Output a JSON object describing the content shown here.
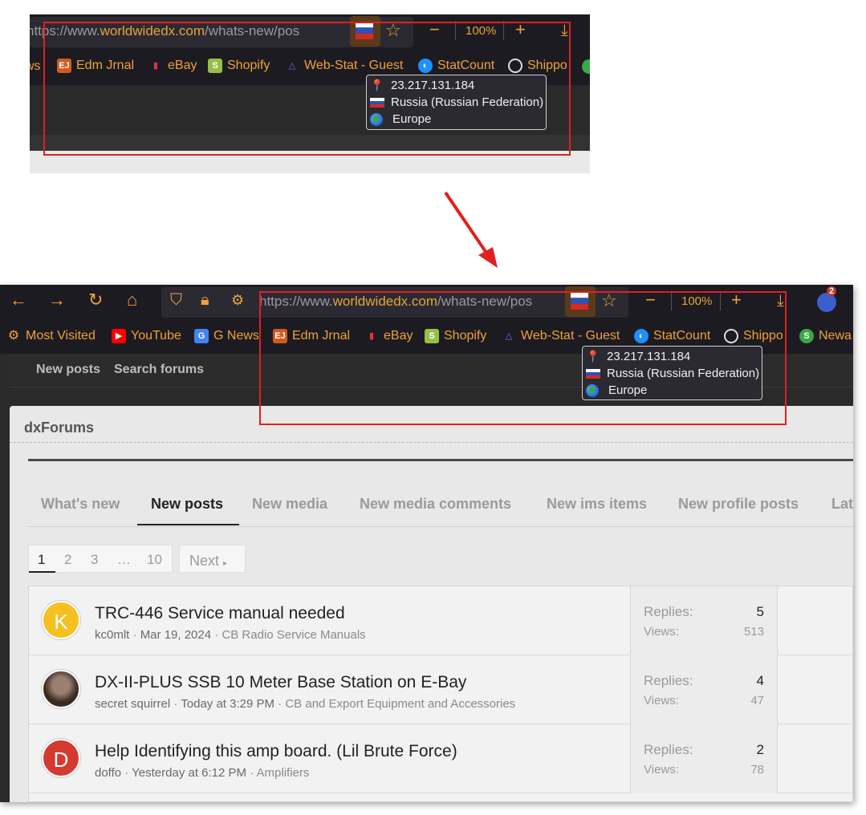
{
  "browser": {
    "url_prefix": "https://www.",
    "url_domain": "worldwidedx.com",
    "url_path_top": "/whats-new/pos",
    "url_path_bottom": "/whats-new/pos",
    "zoom": "100%",
    "badge_count": "2"
  },
  "bookmarks_top": [
    {
      "label": "ws",
      "icon": "bookmark-icon"
    },
    {
      "label": "Edm Jrnal",
      "icon": "ej-icon"
    },
    {
      "label": "eBay",
      "icon": "shopping-bag-icon"
    },
    {
      "label": "Shopify",
      "icon": "shopify-icon"
    },
    {
      "label": "Web-Stat - Guest",
      "icon": "webstat-icon"
    },
    {
      "label": "StatCount",
      "icon": "statcounter-icon"
    },
    {
      "label": "Shippo",
      "icon": "shippo-icon"
    }
  ],
  "bookmarks_bottom": [
    {
      "label": "Most Visited",
      "icon": "gear-icon"
    },
    {
      "label": "YouTube",
      "icon": "youtube-icon"
    },
    {
      "label": "G News",
      "icon": "google-news-icon"
    },
    {
      "label": "Edm Jrnal",
      "icon": "ej-icon"
    },
    {
      "label": "eBay",
      "icon": "shopping-bag-icon"
    },
    {
      "label": "Shopify",
      "icon": "shopify-icon"
    },
    {
      "label": "Web-Stat - Guest",
      "icon": "webstat-icon"
    },
    {
      "label": "StatCount",
      "icon": "statcounter-icon"
    },
    {
      "label": "Shippo",
      "icon": "shippo-icon"
    },
    {
      "label": "Newa",
      "icon": "news-icon"
    }
  ],
  "tooltip": {
    "ip": "23.217.131.184",
    "country": "Russia (Russian Federation)",
    "continent": "Europe"
  },
  "site_nav": {
    "new_posts": "New posts",
    "search_forums": "Search forums"
  },
  "forum": {
    "title": "dxForums",
    "tabs": [
      "What's new",
      "New posts",
      "New media",
      "New media comments",
      "New ims items",
      "New profile posts",
      "Lat"
    ],
    "active_tab": "New posts",
    "pages": [
      "1",
      "2",
      "3",
      "…",
      "10"
    ],
    "current_page": "1",
    "next_label": "Next",
    "replies_label": "Replies:",
    "views_label": "Views:",
    "threads": [
      {
        "avatar_letter": "K",
        "avatar_color": "#f5c020",
        "title": "TRC-446 Service manual needed",
        "author": "kc0mlt",
        "date": "Mar 19, 2024",
        "forum": "CB Radio Service Manuals",
        "replies": "5",
        "views": "513"
      },
      {
        "avatar_letter": "",
        "avatar_color": "#5a4a40",
        "title": "DX-II-PLUS SSB 10 Meter Base Station on E-Bay",
        "author": "secret squirrel",
        "date": "Today at 3:29 PM",
        "forum": "CB and Export Equipment and Accessories",
        "replies": "4",
        "views": "47"
      },
      {
        "avatar_letter": "D",
        "avatar_color": "#d43a30",
        "title": "Help Identifying this amp board. (Lil Brute Force)",
        "author": "doffo",
        "date": "Yesterday at 6:12 PM",
        "forum": "Amplifiers",
        "replies": "2",
        "views": "78"
      }
    ]
  },
  "colors": {
    "accent": "#f0a13a",
    "annotation_red": "#e02020",
    "toolbar_bg": "#1c1b22"
  }
}
